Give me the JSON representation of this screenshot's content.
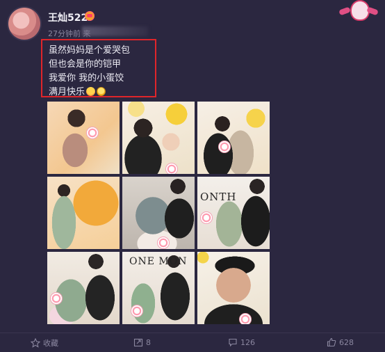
{
  "post": {
    "username": "王灿522",
    "timestamp": "27分钟前 来",
    "lines": [
      "虽然妈妈是个爱哭包",
      "但也会是你的铠甲",
      "我爱你 我的小蛋饺",
      "满月快乐"
    ]
  },
  "photos": {
    "sign_month": "ONTH",
    "sign_onemon": "ONE MON"
  },
  "actions": {
    "favorite_label": "收藏",
    "repost_count": "8",
    "comment_count": "126",
    "like_count": "628"
  },
  "colors": {
    "background": "#2b2740",
    "highlight_border": "#e0252a",
    "text": "#ecebf3",
    "muted": "#8b87a0"
  }
}
